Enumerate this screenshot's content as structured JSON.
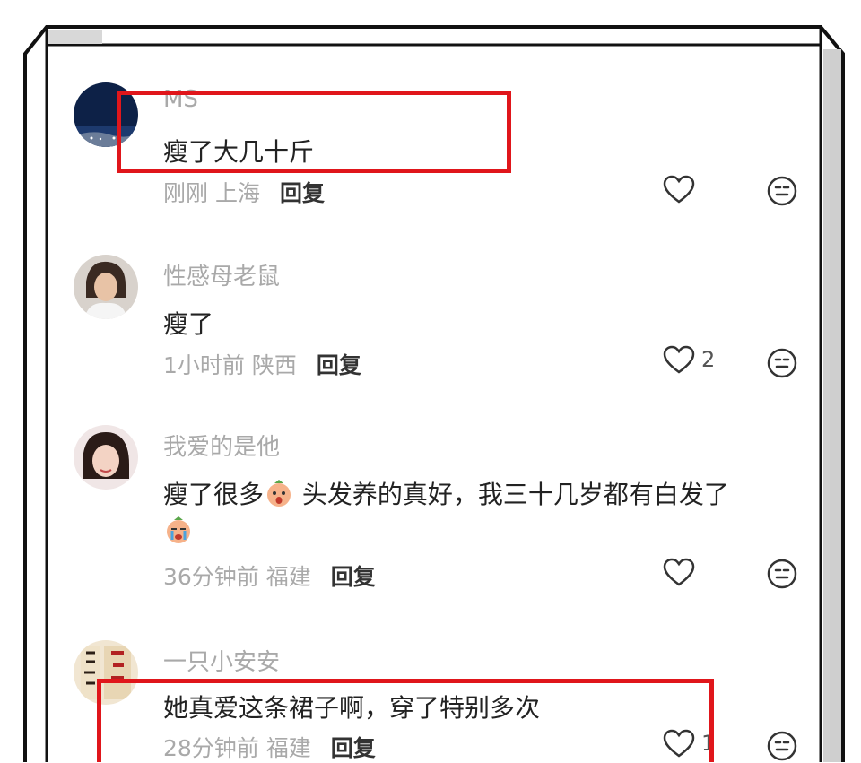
{
  "colors": {
    "highlight": "#e0161b",
    "meta_gray": "#a9a9a9",
    "text": "#222222"
  },
  "comments": [
    {
      "username": "MS",
      "content": "瘦了大几十斤",
      "time": "刚刚",
      "location": "上海",
      "reply_label": "回复",
      "like_count": "",
      "avatar": "night-sky-avatar"
    },
    {
      "username": "性感母老鼠",
      "content": "瘦了",
      "time": "1小时前",
      "location": "陕西",
      "reply_label": "回复",
      "like_count": "2",
      "avatar": "woman-portrait-avatar"
    },
    {
      "username": "我爱的是他",
      "content_a": "瘦了很多",
      "content_b": " 头发养的真好，我三十几岁都有白发了",
      "time": "36分钟前",
      "location": "福建",
      "reply_label": "回复",
      "like_count": "",
      "avatar": "girl-portrait-avatar",
      "emoji_1": "surprised-face-emoji",
      "emoji_2": "crying-face-emoji"
    },
    {
      "username": "一只小安安",
      "content": "她真爱这条裙子啊，穿了特别多次",
      "time": "28分钟前",
      "location": "福建",
      "reply_label": "回复",
      "like_count": "1",
      "avatar": "calligraphy-avatar"
    }
  ]
}
